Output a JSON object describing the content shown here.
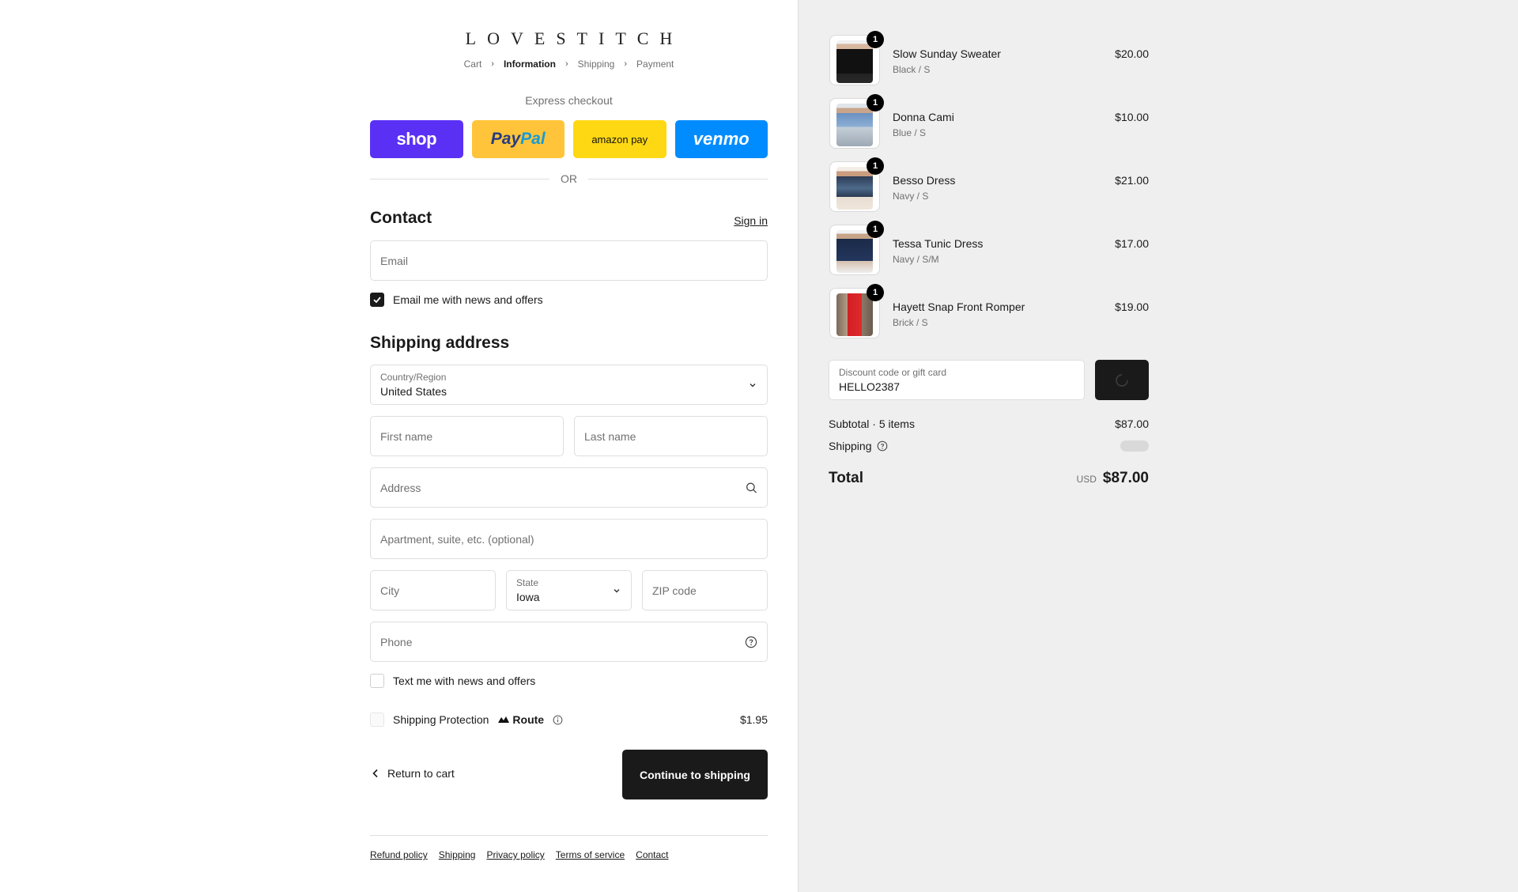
{
  "brand": "LOVESTITCH",
  "breadcrumbs": [
    {
      "label": "Cart"
    },
    {
      "label": "Information"
    },
    {
      "label": "Shipping"
    },
    {
      "label": "Payment"
    }
  ],
  "express": {
    "label": "Express checkout",
    "buttons": {
      "shop": "shop",
      "paypal_a": "Pay",
      "paypal_b": "Pal",
      "amazon": "amazon pay",
      "venmo": "venmo"
    },
    "divider": "OR"
  },
  "contact": {
    "heading": "Contact",
    "signin": "Sign in",
    "email_placeholder": "Email",
    "email_optin": "Email me with news and offers"
  },
  "shipping": {
    "heading": "Shipping address",
    "country_label": "Country/Region",
    "country_value": "United States",
    "first_name_placeholder": "First name",
    "last_name_placeholder": "Last name",
    "address_placeholder": "Address",
    "apartment_placeholder": "Apartment, suite, etc. (optional)",
    "city_placeholder": "City",
    "state_label": "State",
    "state_value": "Iowa",
    "zip_placeholder": "ZIP code",
    "phone_placeholder": "Phone",
    "sms_optin": "Text me with news and offers",
    "protection_label": "Shipping Protection",
    "protection_brand": "Route",
    "protection_price": "$1.95"
  },
  "actions": {
    "back": "Return to cart",
    "continue": "Continue to shipping"
  },
  "footer_links": [
    "Refund policy",
    "Shipping",
    "Privacy policy",
    "Terms of service",
    "Contact"
  ],
  "cart": {
    "items": [
      {
        "name": "Slow Sunday Sweater",
        "variant": "Black / S",
        "price": "$20.00",
        "qty": "1"
      },
      {
        "name": "Donna Cami",
        "variant": "Blue / S",
        "price": "$10.00",
        "qty": "1"
      },
      {
        "name": "Besso Dress",
        "variant": "Navy / S",
        "price": "$21.00",
        "qty": "1"
      },
      {
        "name": "Tessa Tunic Dress",
        "variant": "Navy / S/M",
        "price": "$17.00",
        "qty": "1"
      },
      {
        "name": "Hayett Snap Front Romper",
        "variant": "Brick / S",
        "price": "$19.00",
        "qty": "1"
      }
    ],
    "discount_label": "Discount code or gift card",
    "discount_value": "HELLO2387",
    "subtotal_label": "Subtotal · 5 items",
    "subtotal_value": "$87.00",
    "shipping_label": "Shipping",
    "total_label": "Total",
    "currency": "USD",
    "total_value": "$87.00"
  }
}
